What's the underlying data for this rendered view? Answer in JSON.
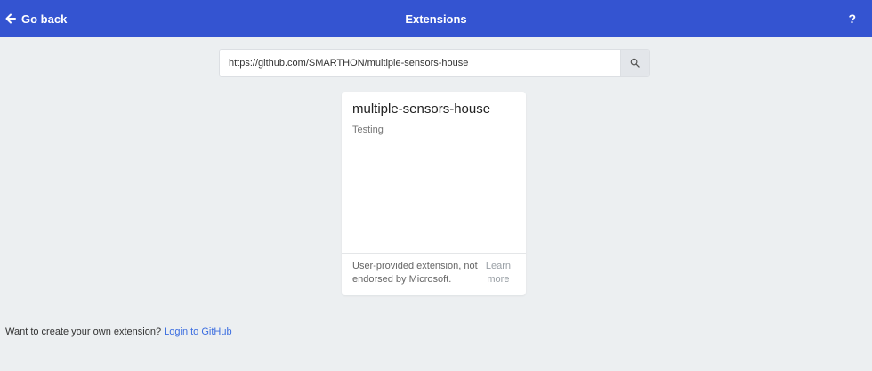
{
  "header": {
    "back_label": "Go back",
    "title": "Extensions",
    "help_label": "?",
    "background": "#3454d1"
  },
  "search": {
    "value": "https://github.com/SMARTHON/multiple-sensors-house",
    "button_icon": "search-icon"
  },
  "card": {
    "name": "multiple-sensors-house",
    "description": "Testing",
    "disclaimer": "User-provided extension, not endorsed by Microsoft.",
    "learn_more": "Learn more"
  },
  "footer": {
    "prompt": "Want to create your own extension?",
    "login_link": "Login to GitHub",
    "link_color": "#3c6ee0"
  }
}
